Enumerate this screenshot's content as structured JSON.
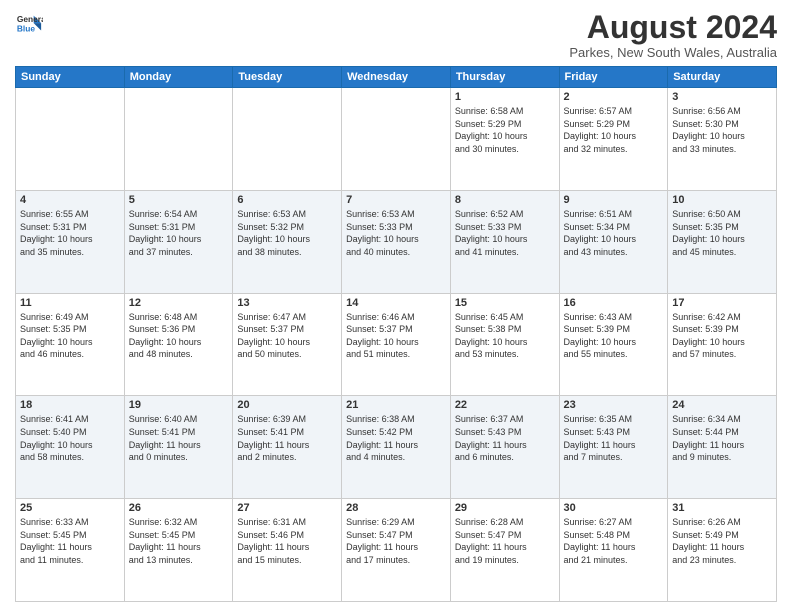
{
  "logo": {
    "line1": "General",
    "line2": "Blue"
  },
  "title": "August 2024",
  "location": "Parkes, New South Wales, Australia",
  "weekdays": [
    "Sunday",
    "Monday",
    "Tuesday",
    "Wednesday",
    "Thursday",
    "Friday",
    "Saturday"
  ],
  "weeks": [
    [
      {
        "day": "",
        "content": ""
      },
      {
        "day": "",
        "content": ""
      },
      {
        "day": "",
        "content": ""
      },
      {
        "day": "",
        "content": ""
      },
      {
        "day": "1",
        "content": "Sunrise: 6:58 AM\nSunset: 5:29 PM\nDaylight: 10 hours\nand 30 minutes."
      },
      {
        "day": "2",
        "content": "Sunrise: 6:57 AM\nSunset: 5:29 PM\nDaylight: 10 hours\nand 32 minutes."
      },
      {
        "day": "3",
        "content": "Sunrise: 6:56 AM\nSunset: 5:30 PM\nDaylight: 10 hours\nand 33 minutes."
      }
    ],
    [
      {
        "day": "4",
        "content": "Sunrise: 6:55 AM\nSunset: 5:31 PM\nDaylight: 10 hours\nand 35 minutes."
      },
      {
        "day": "5",
        "content": "Sunrise: 6:54 AM\nSunset: 5:31 PM\nDaylight: 10 hours\nand 37 minutes."
      },
      {
        "day": "6",
        "content": "Sunrise: 6:53 AM\nSunset: 5:32 PM\nDaylight: 10 hours\nand 38 minutes."
      },
      {
        "day": "7",
        "content": "Sunrise: 6:53 AM\nSunset: 5:33 PM\nDaylight: 10 hours\nand 40 minutes."
      },
      {
        "day": "8",
        "content": "Sunrise: 6:52 AM\nSunset: 5:33 PM\nDaylight: 10 hours\nand 41 minutes."
      },
      {
        "day": "9",
        "content": "Sunrise: 6:51 AM\nSunset: 5:34 PM\nDaylight: 10 hours\nand 43 minutes."
      },
      {
        "day": "10",
        "content": "Sunrise: 6:50 AM\nSunset: 5:35 PM\nDaylight: 10 hours\nand 45 minutes."
      }
    ],
    [
      {
        "day": "11",
        "content": "Sunrise: 6:49 AM\nSunset: 5:35 PM\nDaylight: 10 hours\nand 46 minutes."
      },
      {
        "day": "12",
        "content": "Sunrise: 6:48 AM\nSunset: 5:36 PM\nDaylight: 10 hours\nand 48 minutes."
      },
      {
        "day": "13",
        "content": "Sunrise: 6:47 AM\nSunset: 5:37 PM\nDaylight: 10 hours\nand 50 minutes."
      },
      {
        "day": "14",
        "content": "Sunrise: 6:46 AM\nSunset: 5:37 PM\nDaylight: 10 hours\nand 51 minutes."
      },
      {
        "day": "15",
        "content": "Sunrise: 6:45 AM\nSunset: 5:38 PM\nDaylight: 10 hours\nand 53 minutes."
      },
      {
        "day": "16",
        "content": "Sunrise: 6:43 AM\nSunset: 5:39 PM\nDaylight: 10 hours\nand 55 minutes."
      },
      {
        "day": "17",
        "content": "Sunrise: 6:42 AM\nSunset: 5:39 PM\nDaylight: 10 hours\nand 57 minutes."
      }
    ],
    [
      {
        "day": "18",
        "content": "Sunrise: 6:41 AM\nSunset: 5:40 PM\nDaylight: 10 hours\nand 58 minutes."
      },
      {
        "day": "19",
        "content": "Sunrise: 6:40 AM\nSunset: 5:41 PM\nDaylight: 11 hours\nand 0 minutes."
      },
      {
        "day": "20",
        "content": "Sunrise: 6:39 AM\nSunset: 5:41 PM\nDaylight: 11 hours\nand 2 minutes."
      },
      {
        "day": "21",
        "content": "Sunrise: 6:38 AM\nSunset: 5:42 PM\nDaylight: 11 hours\nand 4 minutes."
      },
      {
        "day": "22",
        "content": "Sunrise: 6:37 AM\nSunset: 5:43 PM\nDaylight: 11 hours\nand 6 minutes."
      },
      {
        "day": "23",
        "content": "Sunrise: 6:35 AM\nSunset: 5:43 PM\nDaylight: 11 hours\nand 7 minutes."
      },
      {
        "day": "24",
        "content": "Sunrise: 6:34 AM\nSunset: 5:44 PM\nDaylight: 11 hours\nand 9 minutes."
      }
    ],
    [
      {
        "day": "25",
        "content": "Sunrise: 6:33 AM\nSunset: 5:45 PM\nDaylight: 11 hours\nand 11 minutes."
      },
      {
        "day": "26",
        "content": "Sunrise: 6:32 AM\nSunset: 5:45 PM\nDaylight: 11 hours\nand 13 minutes."
      },
      {
        "day": "27",
        "content": "Sunrise: 6:31 AM\nSunset: 5:46 PM\nDaylight: 11 hours\nand 15 minutes."
      },
      {
        "day": "28",
        "content": "Sunrise: 6:29 AM\nSunset: 5:47 PM\nDaylight: 11 hours\nand 17 minutes."
      },
      {
        "day": "29",
        "content": "Sunrise: 6:28 AM\nSunset: 5:47 PM\nDaylight: 11 hours\nand 19 minutes."
      },
      {
        "day": "30",
        "content": "Sunrise: 6:27 AM\nSunset: 5:48 PM\nDaylight: 11 hours\nand 21 minutes."
      },
      {
        "day": "31",
        "content": "Sunrise: 6:26 AM\nSunset: 5:49 PM\nDaylight: 11 hours\nand 23 minutes."
      }
    ]
  ]
}
